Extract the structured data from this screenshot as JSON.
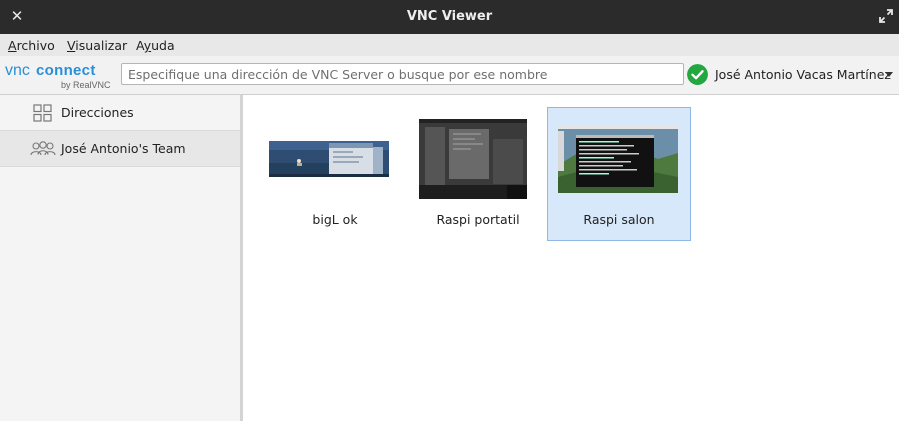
{
  "window": {
    "title": "VNC Viewer"
  },
  "menu": {
    "items": [
      {
        "label": "Archivo",
        "mnemonic": "A",
        "rest": "rchivo"
      },
      {
        "label": "Visualizar",
        "mnemonic": "V",
        "rest": "isualizar"
      },
      {
        "label": "Ayuda",
        "mnemonic": "y",
        "prefix": "A",
        "rest": "uda"
      }
    ]
  },
  "toolbar": {
    "logo_text": "VNC CONNECT",
    "logo_sub": "by RealVNC",
    "search_placeholder": "Especifique una dirección de VNC Server o busque por ese nombre",
    "search_value": "",
    "account_name": "José Antonio Vacas Martínez",
    "brand_color": "#2b8fd6",
    "status_color": "#23a840"
  },
  "sidebar": {
    "items": [
      {
        "label": "Direcciones",
        "icon": "grid-icon",
        "selected": false
      },
      {
        "label": "José Antonio's Team",
        "icon": "team-icon",
        "selected": true
      }
    ]
  },
  "computers": [
    {
      "label": "bigL ok",
      "selected": false
    },
    {
      "label": "Raspi portatil",
      "selected": false
    },
    {
      "label": "Raspi salon",
      "selected": true
    }
  ],
  "colors": {
    "selection_bg": "#d6e8fa",
    "selection_border": "#8db9e6"
  }
}
